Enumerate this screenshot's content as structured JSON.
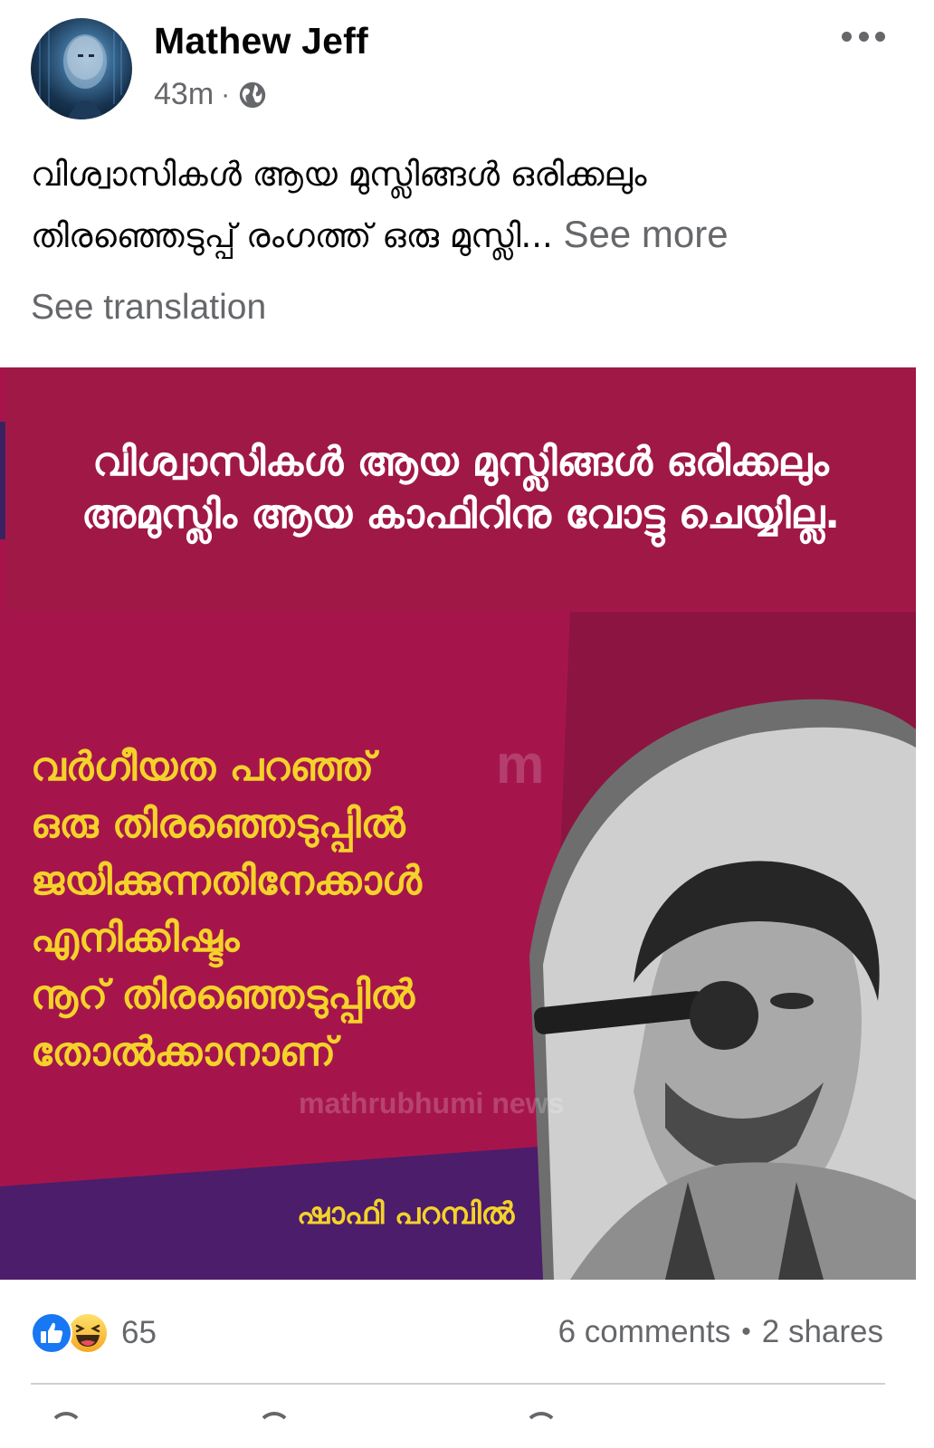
{
  "post": {
    "author": "Mathew Jeff",
    "time": "43m",
    "separator": "·",
    "audience_icon": "globe-icon",
    "text_line1": "വിശ്വാസികൾ ആയ മുസ്ലിങ്ങൾ ഒരിക്കലും",
    "text_line2": "തിരഞ്ഞെടുപ്പ് രംഗത്ത് ഒരു മുസ്ലി...",
    "see_more": "See more",
    "see_translation": "See translation",
    "more_icon": "more-horizontal-icon"
  },
  "image": {
    "headline": "വിശ്വാസികൾ ആയ മുസ്ലിങ്ങൾ ഒരിക്കലും അമുസ്ലിം ആയ കാഫിറിനു വോട്ടു ചെയ്യില്ല.",
    "quote_lines": [
      "വർഗീയത പറഞ്ഞ്",
      "ഒരു തിരഞ്ഞെടുപ്പിൽ",
      "ജയിക്കുന്നതിനേക്കാൾ",
      "എനിക്കിഷ്ടം",
      "നൂറ് തിരഞ്ഞെടുപ്പിൽ",
      "തോൽക്കാനാണ്"
    ],
    "speaker": "ഷാഫി പറമ്പിൽ",
    "watermark_logo": "m",
    "watermark": "mathrubhumi news",
    "colors": {
      "band": "#a01845",
      "background": "#a5154c",
      "quote": "#f5d22a",
      "accent": "#3a2260"
    }
  },
  "footer": {
    "reaction_icons": [
      "like-icon",
      "haha-icon"
    ],
    "reaction_count": "65",
    "comments": "6 comments",
    "dot": "•",
    "shares": "2 shares"
  }
}
